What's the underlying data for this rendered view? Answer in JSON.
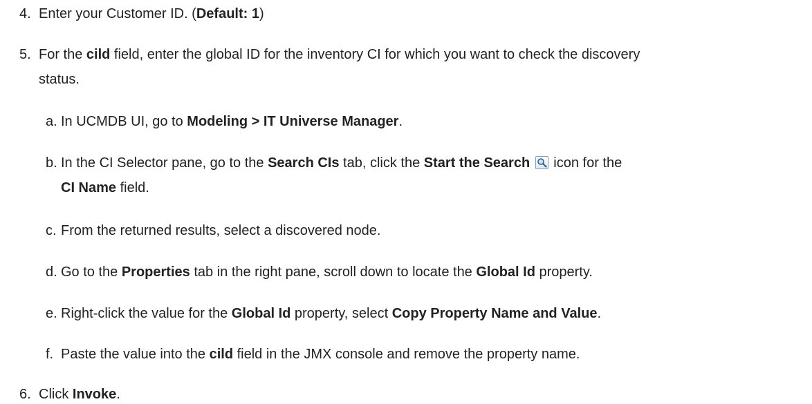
{
  "steps": [
    {
      "num": "4.",
      "t1": "Enter your Customer ID. (",
      "b1": "Default: 1",
      "t2": ")"
    },
    {
      "num": "5.",
      "t1": "For the ",
      "b1": "cild",
      "t2": " field, enter the global ID for the inventory CI for which you want to check the discovery",
      "cont": "status."
    },
    {
      "num": "6.",
      "t1": "Click ",
      "b1": "Invoke",
      "t2": "."
    }
  ],
  "substeps": [
    {
      "letter": "a.",
      "t1": "In UCMDB UI, go to ",
      "b1": "Modeling > IT Universe Manager",
      "t2": "."
    },
    {
      "letter": "b.",
      "t1": "In the CI Selector pane, go to the ",
      "b1": "Search CIs",
      "t2": " tab, click the ",
      "b2": "Start the Search",
      "t3": " icon for the",
      "cont_b": "CI Name",
      "cont_t": " field."
    },
    {
      "letter": "c.",
      "t1": "From the returned results, select a discovered node."
    },
    {
      "letter": "d.",
      "t1": "Go to the ",
      "b1": "Properties",
      "t2": " tab in the right pane, scroll down to locate the ",
      "b2": "Global Id",
      "t3": " property."
    },
    {
      "letter": "e.",
      "t1": "Right-click the value for the ",
      "b1": "Global Id",
      "t2": " property, select ",
      "b2": "Copy Property Name and Value",
      "t3": "."
    },
    {
      "letter": "f.",
      "t1": "Paste the value into the ",
      "b1": "cild",
      "t2": " field in the JMX console and remove the property name."
    }
  ]
}
